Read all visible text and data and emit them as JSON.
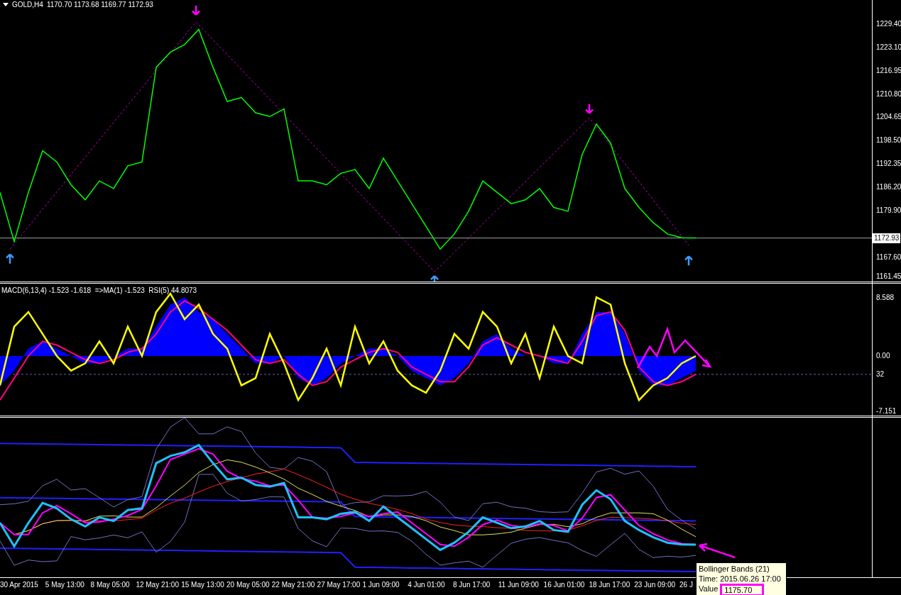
{
  "header": {
    "symbol": "GOLD,H4",
    "quotes": "1170.70 1173.68 1169.77 1172.93"
  },
  "price_pane": {
    "current_price": "1172.93",
    "price_axis": [
      "1229.40",
      "1223.10",
      "1216.95",
      "1210.80",
      "1204.65",
      "1198.50",
      "1192.35",
      "1186.20",
      "1179.90",
      "1167.60",
      "1161.45"
    ]
  },
  "indicator_pane": {
    "legend": "MACD(6,13,4) -1.523 -1.618  =>MA(1) -1.523  RSI(5) 44.8073",
    "value_axis": [
      "8.588",
      "0.00",
      "32",
      "-7.151"
    ]
  },
  "time_axis": [
    "30 Apr 2015",
    "5 May 13:00",
    "8 May 05:00",
    "12 May 21:00",
    "15 May 13:00",
    "20 May 05:00",
    "22 May 21:00",
    "27 May 17:00",
    "1 Jun 09:00",
    "4 Jun 01:00",
    "8 Jun 17:00",
    "11 Jun 09:00",
    "16 Jun 01:00",
    "18 Jun 17:00",
    "23 Jun 09:00",
    "26 J"
  ],
  "tooltip": {
    "title": "Bollinger Bands (21)",
    "time": "Time: 2015.06.26 17:00",
    "value_label": "Value",
    "value": "1175.70"
  }
}
